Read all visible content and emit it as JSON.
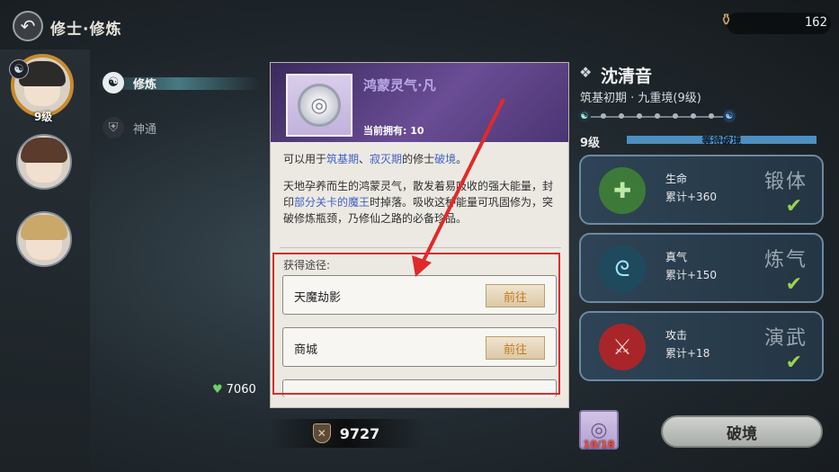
{
  "header": {
    "title": "修士·修炼",
    "currency_value": "162"
  },
  "sidebar": {
    "active_level": "9级",
    "tabs": [
      {
        "label": "修炼",
        "icon": "taiji-swirl-icon",
        "active": true
      },
      {
        "label": "神通",
        "icon": "helmet-icon",
        "active": false
      }
    ]
  },
  "left_stats": {
    "hp": "7060",
    "power": "9727"
  },
  "character": {
    "name": "沈清音",
    "realm": "筑基初期 · 九重境(9级)",
    "level": "9级",
    "progress_text": "等待破境",
    "progress_fraction": 1.0
  },
  "stats": [
    {
      "name": "生命",
      "value": "累计+360",
      "label": "锻体",
      "icon": "heart-plus-icon",
      "color": "#3d7a3a"
    },
    {
      "name": "真气",
      "value": "累计+150",
      "label": "炼气",
      "icon": "spiral-icon",
      "color": "#2b6a86"
    },
    {
      "name": "攻击",
      "value": "累计+18",
      "label": "演武",
      "icon": "sword-icon",
      "color": "#a8262a"
    }
  ],
  "breakthrough": {
    "item_count": "10/18",
    "button_label": "破境"
  },
  "popup": {
    "title": "鸿蒙灵气·凡",
    "owned": "当前拥有: 10",
    "desc1_prefix": "可以用于",
    "desc1_hl1": "筑基期",
    "desc1_sep": "、",
    "desc1_hl2": "寂灭期",
    "desc1_mid": "的修士",
    "desc1_hl3": "破境",
    "desc1_suffix": "。",
    "desc2_a": "天地孕养而生的鸿蒙灵气，散发着易吸收的强大能量，封印",
    "desc2_hl": "部分关卡的魔王",
    "desc2_b": "时掉落。吸收这种能量可巩固修为，突破修炼瓶颈，乃修仙之路的必备珍品。",
    "source_label": "获得途径:",
    "sources": [
      {
        "name": "天魔劫影",
        "button": "前往"
      },
      {
        "name": "商城",
        "button": "前往"
      }
    ]
  }
}
